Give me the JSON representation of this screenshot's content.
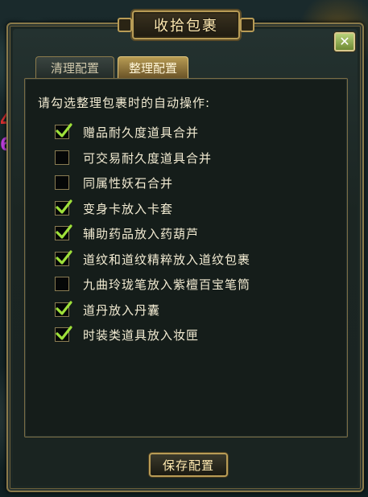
{
  "window": {
    "title": "收拾包裹"
  },
  "tabs": [
    {
      "label": "清理配置",
      "active": false
    },
    {
      "label": "整理配置",
      "active": true
    }
  ],
  "panel": {
    "heading": "请勾选整理包裹时的自动操作:",
    "options": [
      {
        "label": "赠品耐久度道具合并",
        "checked": true
      },
      {
        "label": "可交易耐久度道具合并",
        "checked": false
      },
      {
        "label": "同属性妖石合并",
        "checked": false
      },
      {
        "label": "变身卡放入卡套",
        "checked": true
      },
      {
        "label": "辅助药品放入药葫芦",
        "checked": true
      },
      {
        "label": "道纹和道纹精粹放入道纹包裹",
        "checked": true
      },
      {
        "label": "九曲玲珑笔放入紫檀百宝笔筒",
        "checked": false
      },
      {
        "label": "道丹放入丹囊",
        "checked": true
      },
      {
        "label": "时装类道具放入妆匣",
        "checked": true
      }
    ]
  },
  "save_button": {
    "label": "保存配置"
  },
  "close_button": {
    "icon": "close-icon"
  },
  "colors": {
    "check": "#9ee03a",
    "accent": "#b89c56",
    "text": "#f3ecd3"
  }
}
